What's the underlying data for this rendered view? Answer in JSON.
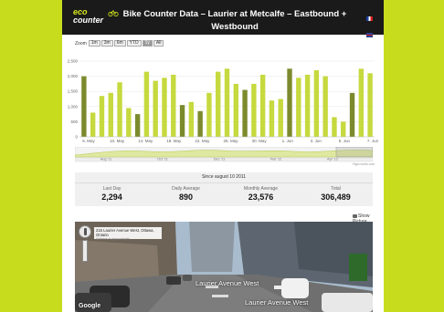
{
  "brand": {
    "line1": "eco",
    "line2": "counter"
  },
  "header": {
    "title_line1": "Bike Counter Data – Laurier at Metcalfe – Eastbound +",
    "title_line2": "Westbound"
  },
  "languages": [
    "fr",
    "en"
  ],
  "zoom": {
    "label": "Zoom",
    "options": [
      "1m",
      "3m",
      "6m",
      "YTD",
      "1y",
      "All"
    ],
    "active": "1y"
  },
  "chart_data": {
    "type": "bar",
    "y_ticks": [
      "2,500",
      "2,000",
      "1,500",
      "1,000",
      "500",
      "0"
    ],
    "ylim": [
      0,
      2500
    ],
    "x_ticks": [
      "6. May",
      "10. May",
      "14. May",
      "18. May",
      "22. May",
      "26. May",
      "30. May",
      "1. Jun",
      "3. Jun",
      "5. Jun",
      "7. Jun"
    ],
    "values": [
      2000,
      800,
      1350,
      1450,
      1800,
      950,
      750,
      2150,
      1850,
      1950,
      2050,
      1050,
      1150,
      850,
      1450,
      2150,
      2250,
      1750,
      1550,
      1750,
      2050,
      1200,
      1250,
      2250,
      1950,
      2050,
      2200,
      2000,
      650,
      500,
      1450,
      2250,
      2100
    ],
    "dark_indices": [
      0,
      6,
      11,
      13,
      18,
      23,
      30
    ],
    "colors": {
      "light": "#c6d93e",
      "dark": "#7c8a2d",
      "grid": "#e6e6e6"
    }
  },
  "navigator": {
    "labels": [
      "Aug '11",
      "Oct '11",
      "Dec '11",
      "Feb '12",
      "Apr '12"
    ],
    "credit": "Highcharts.com"
  },
  "stats": {
    "since": "Since august 10 2011",
    "items": [
      {
        "label": "Last Day",
        "value": "2,294"
      },
      {
        "label": "Daily Average",
        "value": "890"
      },
      {
        "label": "Monthly Average",
        "value": "23,576"
      },
      {
        "label": "Total",
        "value": "306,489"
      }
    ]
  },
  "show_picture": "Show Picture",
  "streetview": {
    "address": "215 Laurier Avenue West, Ottawa, Ontario",
    "sub": "Address is approximate",
    "street1": "Laurier Avenue West",
    "street2": "Laurier Avenue West",
    "google": "Google"
  }
}
